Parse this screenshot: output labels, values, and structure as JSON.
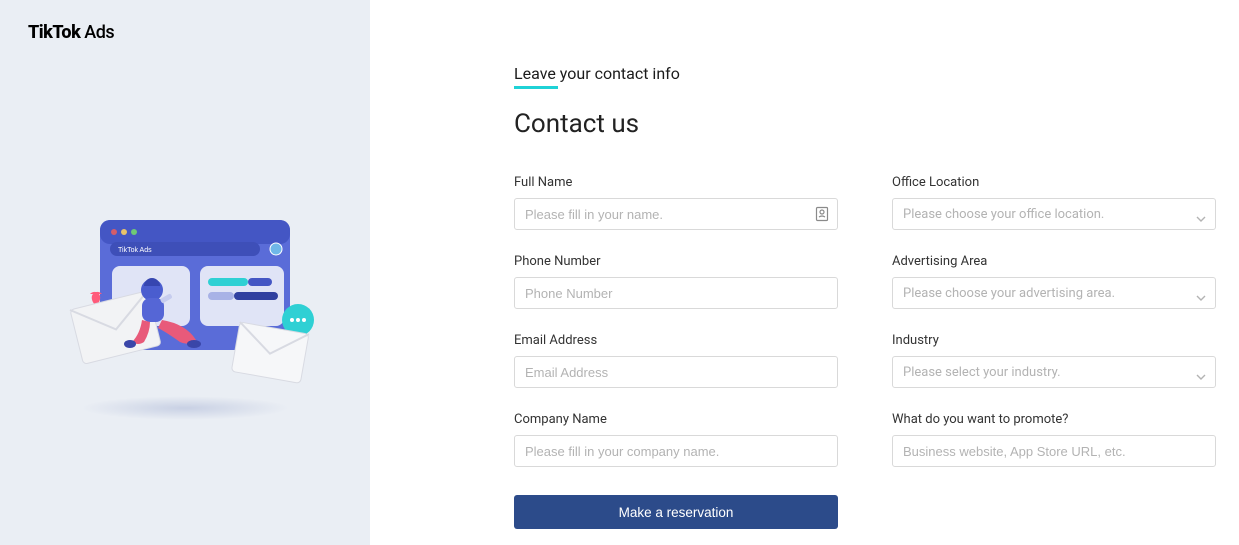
{
  "logo": {
    "text_bold": "TikTok",
    "text_light": " Ads"
  },
  "eyebrow": "Leave your contact info",
  "title": "Contact us",
  "fields": {
    "full_name": {
      "label": "Full Name",
      "placeholder": "Please fill in your name."
    },
    "phone": {
      "label": "Phone Number",
      "placeholder": "Phone Number"
    },
    "email": {
      "label": "Email Address",
      "placeholder": "Email Address"
    },
    "company": {
      "label": "Company Name",
      "placeholder": "Please fill in your company name."
    },
    "office": {
      "label": "Office Location",
      "placeholder": "Please choose your office location."
    },
    "ad_area": {
      "label": "Advertising Area",
      "placeholder": "Please choose your advertising area."
    },
    "industry": {
      "label": "Industry",
      "placeholder": "Please select your industry."
    },
    "promote": {
      "label": "What do you want to promote?",
      "placeholder": "Business website, App Store URL, etc."
    }
  },
  "submit_label": "Make a reservation",
  "illustration": {
    "app_label": "TikTok Ads"
  }
}
